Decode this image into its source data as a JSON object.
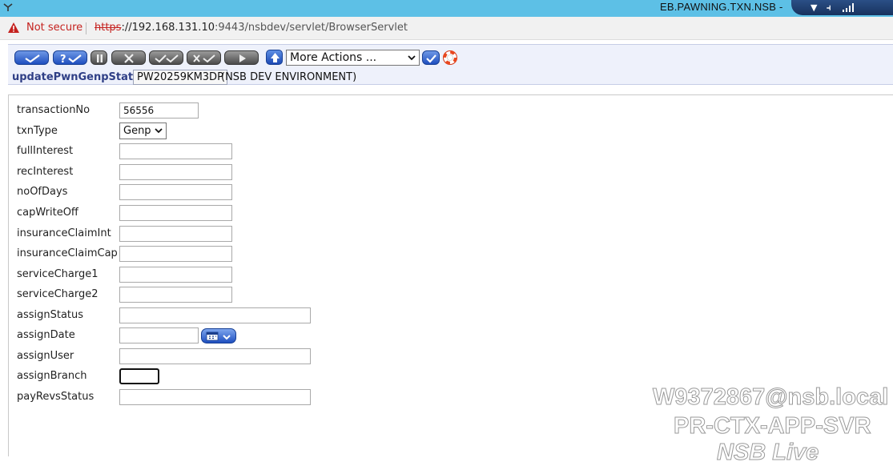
{
  "window": {
    "title": "EB.PAWNING.TXN.NSB -"
  },
  "browser": {
    "security_label": "Not secure",
    "url_scheme": "https",
    "url_host": "://192.168.131.10",
    "url_path": ":9443/nsbdev/servlet/BrowserServlet"
  },
  "toolbar": {
    "more_actions": "More Actions ...",
    "application": "updatePwnGenpStatus",
    "record_id": "PW20259KM3DP",
    "environment": "(NSB DEV ENVIRONMENT)"
  },
  "form": {
    "fields": [
      {
        "label": "transactionNo",
        "value": "56556"
      },
      {
        "label": "txnType",
        "value": "Genp"
      },
      {
        "label": "fullInterest",
        "value": ""
      },
      {
        "label": "recInterest",
        "value": ""
      },
      {
        "label": "noOfDays",
        "value": ""
      },
      {
        "label": "capWriteOff",
        "value": ""
      },
      {
        "label": "insuranceClaimInt",
        "value": ""
      },
      {
        "label": "insuranceClaimCap",
        "value": ""
      },
      {
        "label": "serviceCharge1",
        "value": ""
      },
      {
        "label": "serviceCharge2",
        "value": ""
      },
      {
        "label": "assignStatus",
        "value": ""
      },
      {
        "label": "assignDate",
        "value": ""
      },
      {
        "label": "assignUser",
        "value": ""
      },
      {
        "label": "assignBranch",
        "value": ""
      },
      {
        "label": "payRevsStatus",
        "value": ""
      }
    ]
  },
  "watermark": {
    "user": "W9372867@nsb.local",
    "server": "PR-CTX-APP-SVR",
    "env": "NSB Live"
  }
}
